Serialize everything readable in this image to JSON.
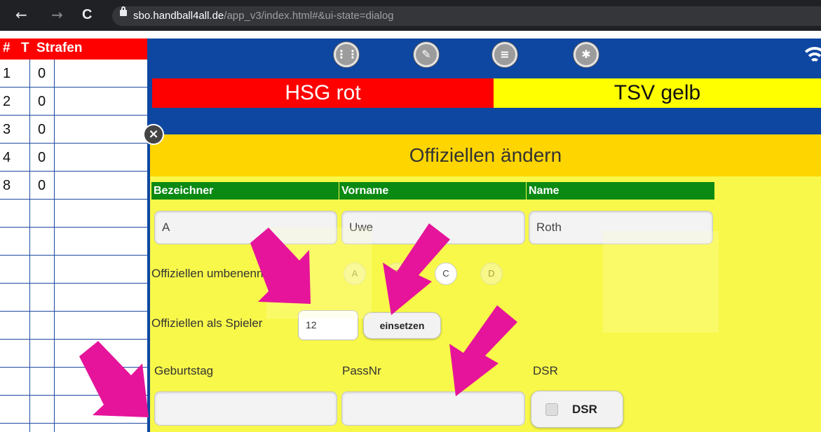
{
  "browser": {
    "back": "←",
    "forward": "→",
    "reload": "C",
    "url_domain": "sbo.handball4all.de",
    "url_path": "/app_v3/index.html#&ui-state=dialog"
  },
  "penalty_table": {
    "headers": {
      "num": "#",
      "t": "T",
      "strafen": "Strafen"
    },
    "rows": [
      {
        "num": "1",
        "t": "0"
      },
      {
        "num": "2",
        "t": "0"
      },
      {
        "num": "3",
        "t": "0"
      },
      {
        "num": "4",
        "t": "0"
      },
      {
        "num": "8",
        "t": "0"
      }
    ],
    "header_color": "#ff0000",
    "grid_color": "#1c4aa0"
  },
  "toolbar": {
    "icons": [
      "grid-icon",
      "pencil-icon",
      "list-icon",
      "settings-icon",
      "wifi-icon"
    ]
  },
  "teams": {
    "home": {
      "name": "HSG rot",
      "color": "#ff0000"
    },
    "away": {
      "name": "TSV gelb",
      "color": "#ffff00"
    }
  },
  "dialog": {
    "title": "Offiziellen ändern",
    "columns": {
      "bezeichner": "Bezeichner",
      "vorname": "Vorname",
      "name": "Name"
    },
    "values": {
      "bezeichner": "A",
      "vorname": "Uwe",
      "name": "Roth"
    },
    "rename_label": "Offiziellen umbenennen zu",
    "rename_options": [
      "A",
      "B",
      "C",
      "D"
    ],
    "rename_selected": "C",
    "as_player_label": "Offiziellen als Spieler",
    "as_player_value": "12",
    "einsetzen_label": "einsetzen",
    "geburtstag_label": "Geburtstag",
    "passnr_label": "PassNr",
    "dsr_label": "DSR",
    "dsr_button": "DSR",
    "dsr_checked": false,
    "header_color": "#ffd500",
    "body_color": "#f8f84a",
    "column_header_color": "#0a8a12"
  },
  "annotation_color": "#e5149a"
}
